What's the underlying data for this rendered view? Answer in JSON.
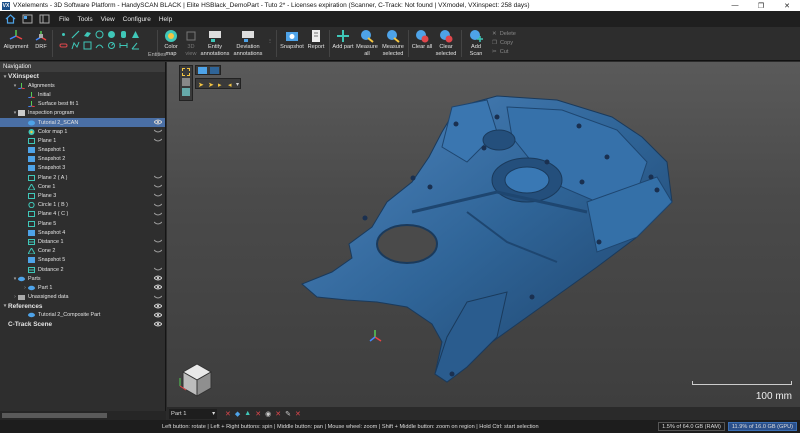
{
  "window": {
    "title": "VXelements - 3D Software Platform - HandySCAN BLACK | Elite HSBlack_DemoPart - Tuto 2* - Licenses expiration (Scanner, C-Track: Not found | VXmodel, VXinspect: 258 days)",
    "app_icon": "VX"
  },
  "menu": [
    "File",
    "Tools",
    "View",
    "Configure",
    "Help"
  ],
  "ribbon": {
    "alignment": "Alignment",
    "drf": "DRF",
    "entities": "Entities",
    "color_map": "Color map",
    "view_3d": "3D view",
    "entity_annotations": "Entity annotations",
    "deviation_annotations": "Deviation annotations",
    "snapshot": "Snapshot",
    "report": "Report",
    "add_part": "Add part",
    "measure_all": "Measure all",
    "measure_selected": "Measure selected",
    "clear_all": "Clear all",
    "clear_selected": "Clear selected",
    "add_scan": "Add Scan",
    "delete": "Delete",
    "copy": "Copy",
    "cut": "Cut"
  },
  "navigation": {
    "header": "Navigation",
    "items": [
      {
        "label": "VXinspect",
        "level": 0,
        "type": "header",
        "arrow": "▾",
        "icon": "none"
      },
      {
        "label": "Alignments",
        "level": 1,
        "arrow": "▾",
        "icon": "alignment-icon"
      },
      {
        "label": "Initial",
        "level": 2,
        "icon": "alignment-icon"
      },
      {
        "label": "Surface best fit 1",
        "level": 2,
        "icon": "alignment-icon"
      },
      {
        "label": "Inspection program",
        "level": 1,
        "arrow": "▾",
        "icon": "program-icon"
      },
      {
        "label": "Tutorial 2_SCAN",
        "level": 2,
        "selected": true,
        "icon": "scan-icon",
        "eye": true
      },
      {
        "label": "Color map 1",
        "level": 2,
        "icon": "colormap-icon",
        "eye": true
      },
      {
        "label": "Plane 1",
        "level": 2,
        "icon": "plane-icon",
        "eye": true
      },
      {
        "label": "Snapshot 1",
        "level": 2,
        "icon": "snapshot-icon"
      },
      {
        "label": "Snapshot 2",
        "level": 2,
        "icon": "snapshot-icon"
      },
      {
        "label": "Snapshot 3",
        "level": 2,
        "icon": "snapshot-icon"
      },
      {
        "label": "Plane 2 ( A )",
        "level": 2,
        "icon": "plane-icon",
        "eye": true
      },
      {
        "label": "Cone 1",
        "level": 2,
        "icon": "cone-icon",
        "eye": true
      },
      {
        "label": "Plane 3",
        "level": 2,
        "icon": "plane-icon",
        "eye": true
      },
      {
        "label": "Circle 1 ( B )",
        "level": 2,
        "icon": "circle-icon",
        "eye": true
      },
      {
        "label": "Plane 4 ( C )",
        "level": 2,
        "icon": "plane-icon",
        "eye": true
      },
      {
        "label": "Plane 5",
        "level": 2,
        "icon": "plane-icon",
        "eye": true
      },
      {
        "label": "Snapshot 4",
        "level": 2,
        "icon": "snapshot-icon"
      },
      {
        "label": "Distance 1",
        "level": 2,
        "icon": "distance-icon",
        "eye": true
      },
      {
        "label": "Cone 2",
        "level": 2,
        "icon": "cone-icon",
        "eye": true
      },
      {
        "label": "Snapshot 5",
        "level": 2,
        "icon": "snapshot-icon"
      },
      {
        "label": "Distance 2",
        "level": 2,
        "icon": "distance-icon",
        "eye": true
      },
      {
        "label": "Parts",
        "level": 1,
        "arrow": "▾",
        "icon": "part-icon",
        "eye": true
      },
      {
        "label": "Part 1",
        "level": 2,
        "arrow": "›",
        "icon": "part-icon",
        "eye": true
      },
      {
        "label": "Unassigned data",
        "level": 1,
        "arrow": "›",
        "icon": "folder-icon",
        "eye": true
      },
      {
        "label": "References",
        "level": 0,
        "type": "header",
        "arrow": "▾",
        "icon": "none",
        "eye": true
      },
      {
        "label": "Tutorial 2_Composite Part",
        "level": 2,
        "icon": "part-icon",
        "eye": true
      },
      {
        "label": "C-Track Scene",
        "level": 0,
        "type": "header",
        "icon": "none",
        "eye": true
      }
    ]
  },
  "viewport": {
    "scale_label": "100 mm",
    "part_color": "#2f6497"
  },
  "bottombar": {
    "part_selector": "Part 1"
  },
  "status": {
    "hint": "Left button: rotate | Left + Right buttons: spin | Middle button: pan | Mouse wheel: zoom | Shift + Middle button: zoom on region | Hold Ctrl: start selection",
    "ram": "1.5% of 64.0 GB (RAM)",
    "gpu": "11.9% of 16.0 GB (GPU)"
  }
}
